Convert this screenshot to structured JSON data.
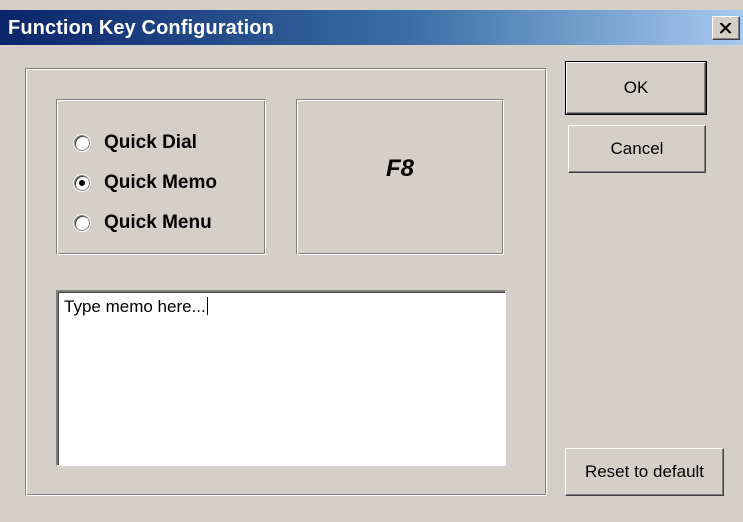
{
  "window": {
    "title": "Function Key Configuration",
    "title_gradient": [
      "#0a246a",
      "#a6caf0"
    ],
    "background": "#d4d0c8"
  },
  "mode_group": {
    "options": [
      {
        "label": "Quick Dial",
        "selected": false
      },
      {
        "label": "Quick Memo",
        "selected": true
      },
      {
        "label": "Quick Menu",
        "selected": false
      }
    ]
  },
  "function_key": {
    "label": "F8"
  },
  "memo": {
    "value": "Type memo here..."
  },
  "buttons": {
    "ok_label": "OK",
    "cancel_label": "Cancel",
    "reset_label": "Reset to default"
  }
}
